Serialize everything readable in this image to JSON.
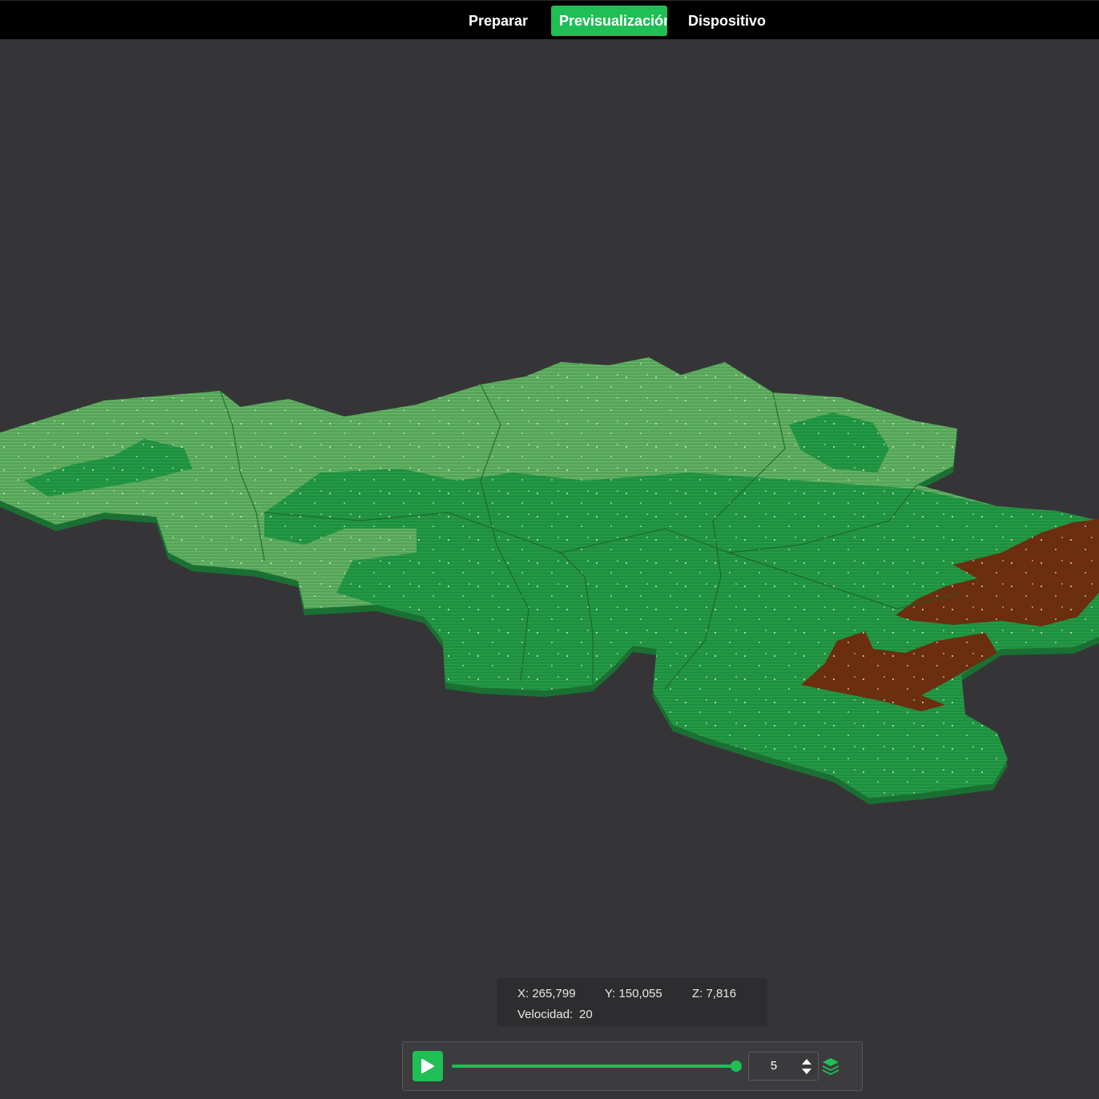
{
  "tabs": [
    {
      "label": "Preparar",
      "active": false
    },
    {
      "label": "Previsualización",
      "active": true
    },
    {
      "label": "Dispositivo",
      "active": false
    }
  ],
  "viewport": {
    "model": "terrain-relief-map",
    "colors": {
      "background": "#353537",
      "lowland": "#1e8f3f",
      "upland": "#55a457",
      "highland": "#6b2e0e",
      "edge": "#15632b",
      "accent": "#1fbf55"
    }
  },
  "coords": {
    "x": "X: 265,799",
    "y": "Y: 150,055",
    "z": "Z: 7,816",
    "speed_label": "Velocidad:",
    "speed_value": "20"
  },
  "controls": {
    "progress": 1.0,
    "layer_value": "5",
    "icons": [
      "play-icon",
      "arrow-up-icon",
      "arrow-down-icon",
      "layers-icon"
    ]
  }
}
